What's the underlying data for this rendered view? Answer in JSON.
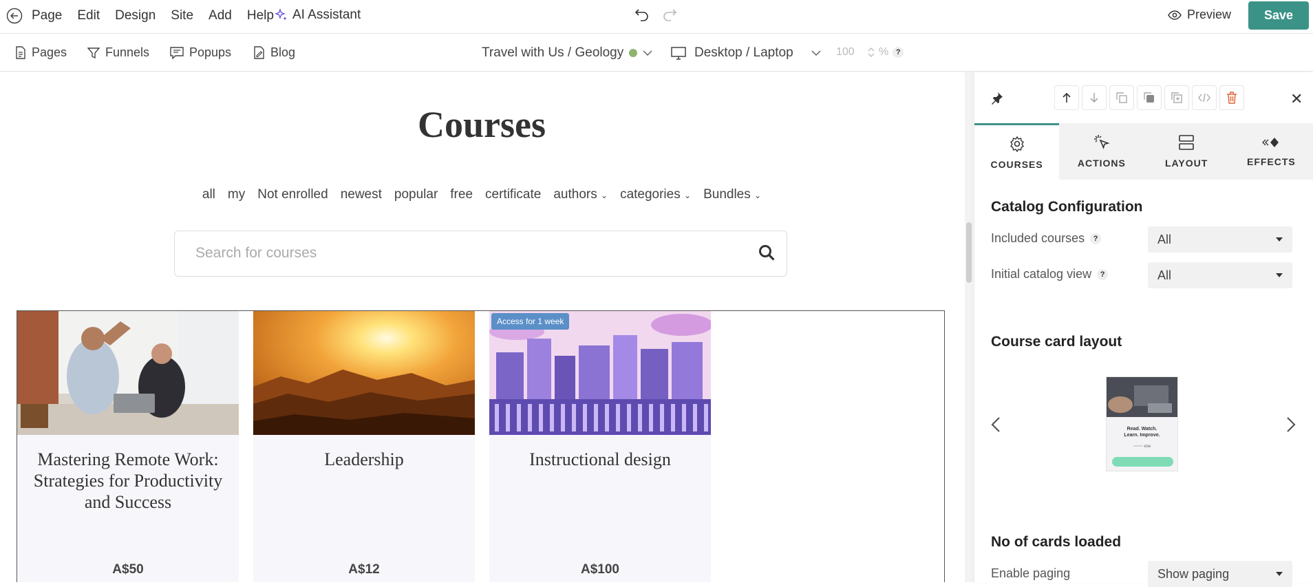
{
  "topbar": {
    "menu": [
      "Page",
      "Edit",
      "Design",
      "Site",
      "Add",
      "Help"
    ],
    "ai_label": "AI Assistant",
    "preview_label": "Preview",
    "save_label": "Save"
  },
  "subbar": {
    "nav": [
      "Pages",
      "Funnels",
      "Popups",
      "Blog"
    ],
    "site_path": "Travel with Us / Geology",
    "site_status_color": "#8fb36d",
    "device": "Desktop / Laptop",
    "zoom_value": "100",
    "zoom_unit": "%",
    "help": "?"
  },
  "canvas": {
    "title": "Courses",
    "filters": [
      "all",
      "my",
      "Not enrolled",
      "newest",
      "popular",
      "free",
      "certificate"
    ],
    "filter_dropdowns": [
      "authors",
      "categories",
      "Bundles"
    ],
    "search_placeholder": "Search for courses",
    "cards": [
      {
        "title": "Mastering Remote Work: Strategies for Productivity and Success",
        "price": "A$50"
      },
      {
        "title": "Leadership",
        "price": "A$12"
      },
      {
        "title": "Instructional design",
        "price": "A$100",
        "badge": "Access for 1 week"
      }
    ]
  },
  "panel": {
    "tabs": [
      "COURSES",
      "ACTIONS",
      "LAYOUT",
      "EFFECTS"
    ],
    "catalog_title": "Catalog Configuration",
    "included_label": "Included courses",
    "included_value": "All",
    "initial_label": "Initial catalog view",
    "initial_value": "All",
    "card_layout_title": "Course card layout",
    "preview_card": {
      "headline": "Read. Watch. Learn. Improve."
    },
    "cards_loaded_title": "No of cards loaded",
    "paging_label": "Enable paging",
    "paging_value": "Show paging",
    "accent": "#3b9388"
  }
}
